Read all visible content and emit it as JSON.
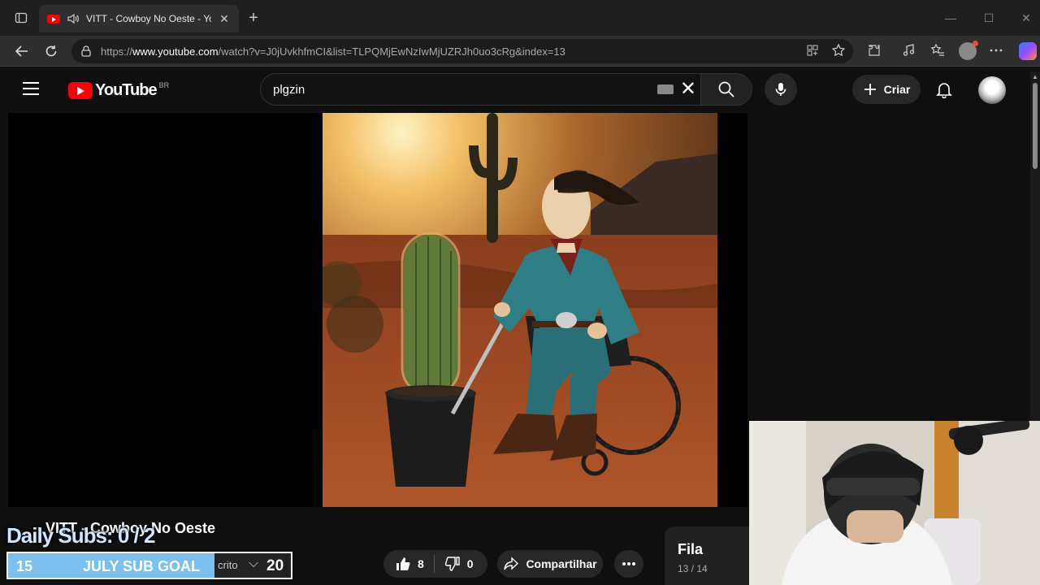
{
  "browser": {
    "tab_title": "VITT - Cowboy No Oeste - YouTube",
    "url_prefix": "https://",
    "url_domain": "www.youtube.com",
    "url_path": "/watch?v=J0jUvkhfmCI&list=TLPQMjEwNzIwMjUZRJh0uo3cRg&index=13"
  },
  "youtube": {
    "logo_text": "YouTube",
    "region": "BR",
    "search_query": "plgzin",
    "create_label": "Criar"
  },
  "video": {
    "title": "VITT - Cowboy No Oeste",
    "likes": "8",
    "dislikes": "0",
    "share_label": "Compartilhar"
  },
  "queue": {
    "label": "Fila",
    "position": "13 / 14"
  },
  "overlay": {
    "daily_subs": "Daily Subs:  0 / 2",
    "goal_start": "15",
    "goal_label": "JULY SUB GOAL",
    "goal_behind_text": "crito",
    "goal_end": "20",
    "goal_progress": 0.73
  },
  "colors": {
    "youtube_red": "#ff0000",
    "goal_fill": "#7cc0ef",
    "page_bg": "#0f0f0f"
  }
}
